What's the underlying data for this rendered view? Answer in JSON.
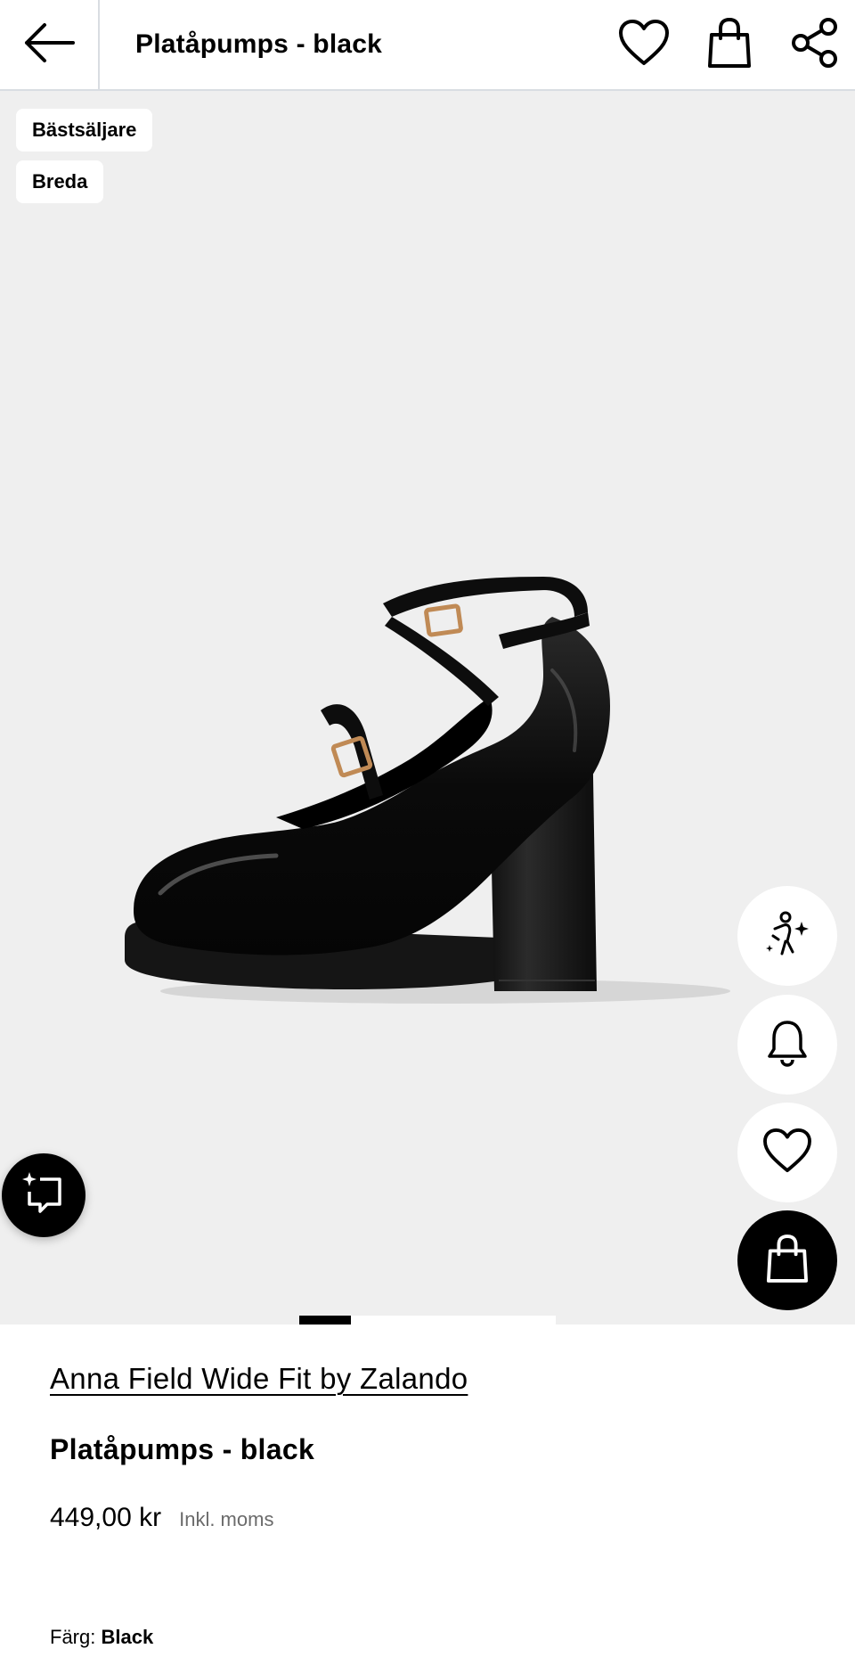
{
  "topbar": {
    "title": "Platåpumps - black",
    "icons": [
      "back-arrow-icon",
      "heart-icon",
      "shopping-bag-icon",
      "share-icon"
    ]
  },
  "gallery": {
    "flags": [
      "Bästsäljare",
      "Breda"
    ],
    "side_actions": [
      "try-on-sparkle-icon",
      "bell-icon",
      "heart-icon",
      "shopping-bag-icon"
    ],
    "ai_assistant_icon": "sparkle-chat-icon",
    "pager": {
      "active_index": 0,
      "count": 5
    }
  },
  "product": {
    "brand": "Anna Field Wide Fit by Zalando",
    "name": "Platåpumps - black",
    "price": "449,00 kr",
    "vat_note": "Inkl. moms",
    "color_label": "Färg:",
    "color_value": "Black"
  },
  "colors": {
    "hero_bg": "#efefef",
    "accent": "#000000",
    "divider": "#d9dde2",
    "muted_text": "#6b6b6b"
  }
}
